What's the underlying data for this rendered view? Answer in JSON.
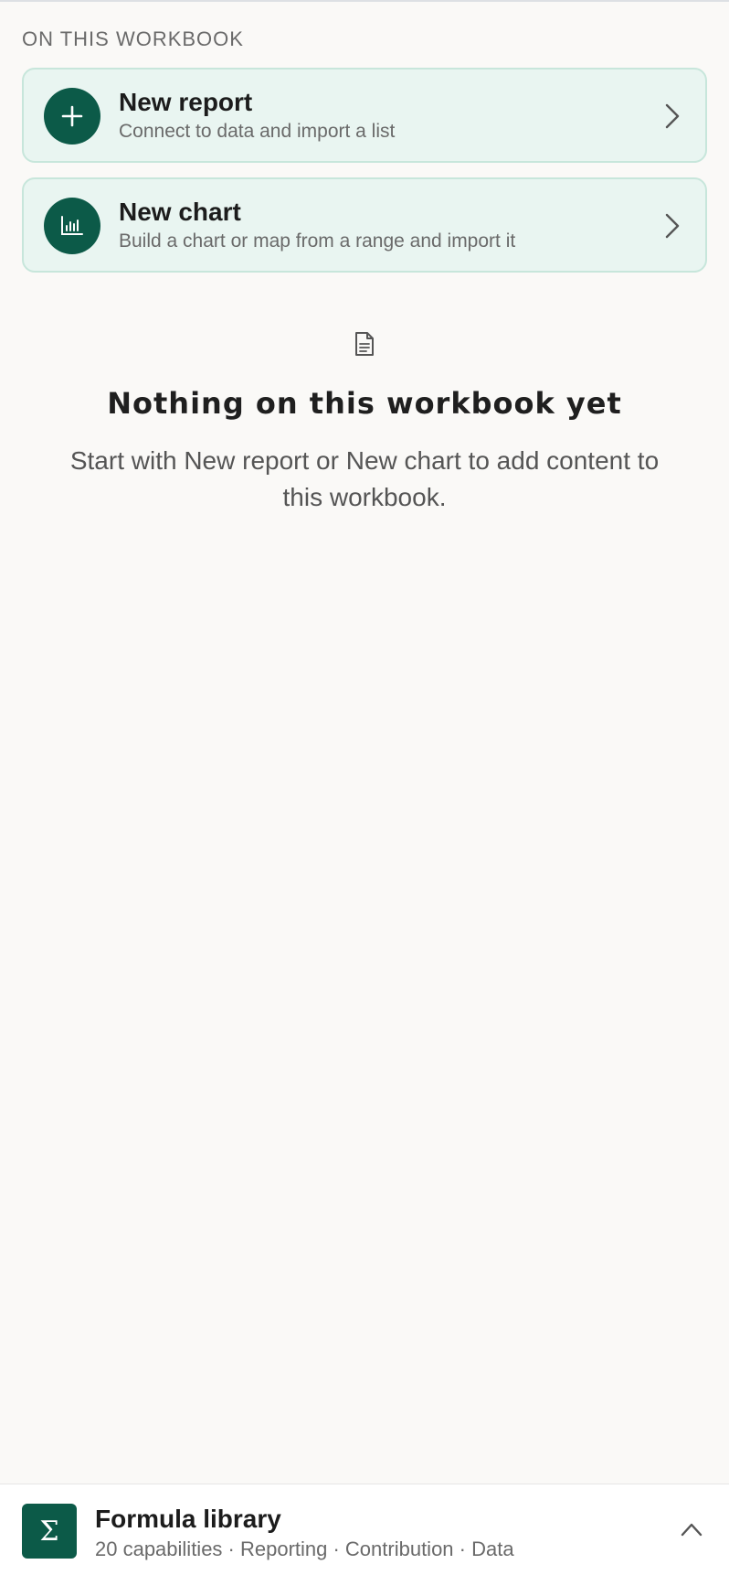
{
  "section": {
    "label": "ON THIS WORKBOOK"
  },
  "actions": [
    {
      "title": "New report",
      "subtitle": "Connect to data and import a list",
      "icon": "plus-icon"
    },
    {
      "title": "New chart",
      "subtitle": "Build a chart or map from a range and import it",
      "icon": "chart-bars-icon"
    }
  ],
  "empty_state": {
    "icon": "document-icon",
    "title": "Nothing on this workbook yet",
    "body": "Start with New report or New chart to add content to this workbook."
  },
  "bottom_bar": {
    "icon_glyph": "Σ",
    "title": "Formula library",
    "subtitle": "20 capabilities · Reporting · Contribution · Data"
  },
  "colors": {
    "accent": "#0c5a48",
    "card_bg": "#e9f5f1",
    "card_border": "#c7e6db",
    "page_bg": "#faf9f7"
  }
}
